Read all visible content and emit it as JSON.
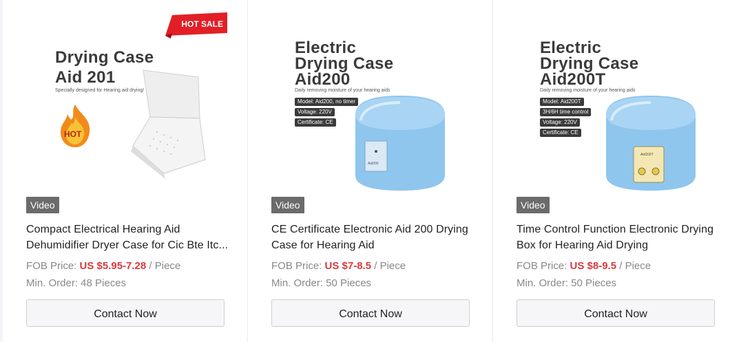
{
  "products": [
    {
      "badge": "Video",
      "title_line1": "Compact Electrical Hearing Aid",
      "title_line2": "Dehumidifier Dryer Case for Cic Bte Itc...",
      "price_prefix": "FOB Price: ",
      "price": "US $5.95-7.28",
      "price_suffix": " / Piece",
      "moq": "Min. Order: 48 Pieces",
      "button": "Contact Now",
      "image": {
        "title_line1": "Drying Case",
        "title_line2": "Aid 201",
        "subtitle": "Specially designed for Hearing aid drying!",
        "hot_sale": "HOT SALE",
        "hot": "HOT"
      }
    },
    {
      "badge": "Video",
      "title_line1": "CE Certificate Electronic Aid 200 Drying",
      "title_line2": "Case for Hearing Aid",
      "price_prefix": "FOB Price: ",
      "price": "US $7-8.5",
      "price_suffix": " / Piece",
      "moq": "Min. Order: 50 Pieces",
      "button": "Contact Now",
      "image": {
        "title_line1": "Electric",
        "title_line2": "Drying Case",
        "title_line3": "Aid200",
        "subtitle": "Daily removing moisture of your hearing aids",
        "specs": [
          "Model: Aid200, no timer",
          "Voltage: 220V",
          "Certificate: CE"
        ],
        "device_label": "Aid200"
      }
    },
    {
      "badge": "Video",
      "title_line1": "Time Control Function Electronic Drying",
      "title_line2": "Box for Hearing Aid Drying",
      "price_prefix": "FOB Price: ",
      "price": "US $8-9.5",
      "price_suffix": " / Piece",
      "moq": "Min. Order: 50 Pieces",
      "button": "Contact Now",
      "image": {
        "title_line1": "Electric",
        "title_line2": "Drying Case",
        "title_line3": "Aid200T",
        "subtitle": "Daily removing moisture of your hearing aids",
        "specs": [
          "Model: Aid200T",
          "3H/6H time control",
          "Voltage: 220V",
          "Certificate: CE"
        ],
        "device_label": "Aid200T"
      }
    }
  ],
  "colors": {
    "price": "#d8393e",
    "device_blue": "#8fc6ee",
    "hot_sale_red": "#e21f26"
  }
}
